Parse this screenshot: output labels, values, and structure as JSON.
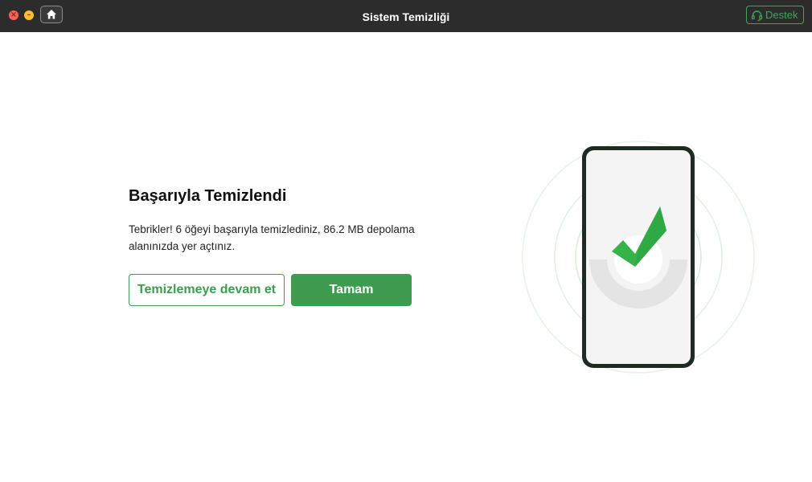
{
  "window": {
    "title": "Sistem Temizliği",
    "support_label": "Destek"
  },
  "icons": {
    "close": "close-icon",
    "minimize": "minimize-icon",
    "home": "home-icon",
    "support": "headset-icon",
    "success": "checkmark-icon",
    "phone": "phone-icon"
  },
  "main": {
    "title": "Başarıyla Temizlendi",
    "description": "Tebrikler! 6 öğeyi başarıyla temizlediniz, 86.2 MB depolama alanınızda yer açtınız.",
    "continue_label": "Temizlemeye devam et",
    "ok_label": "Tamam"
  },
  "colors": {
    "accent": "#3d9c4f",
    "titlebar": "#2c2c2c",
    "check": "#35b34a",
    "phone_border": "#1f2a22"
  }
}
